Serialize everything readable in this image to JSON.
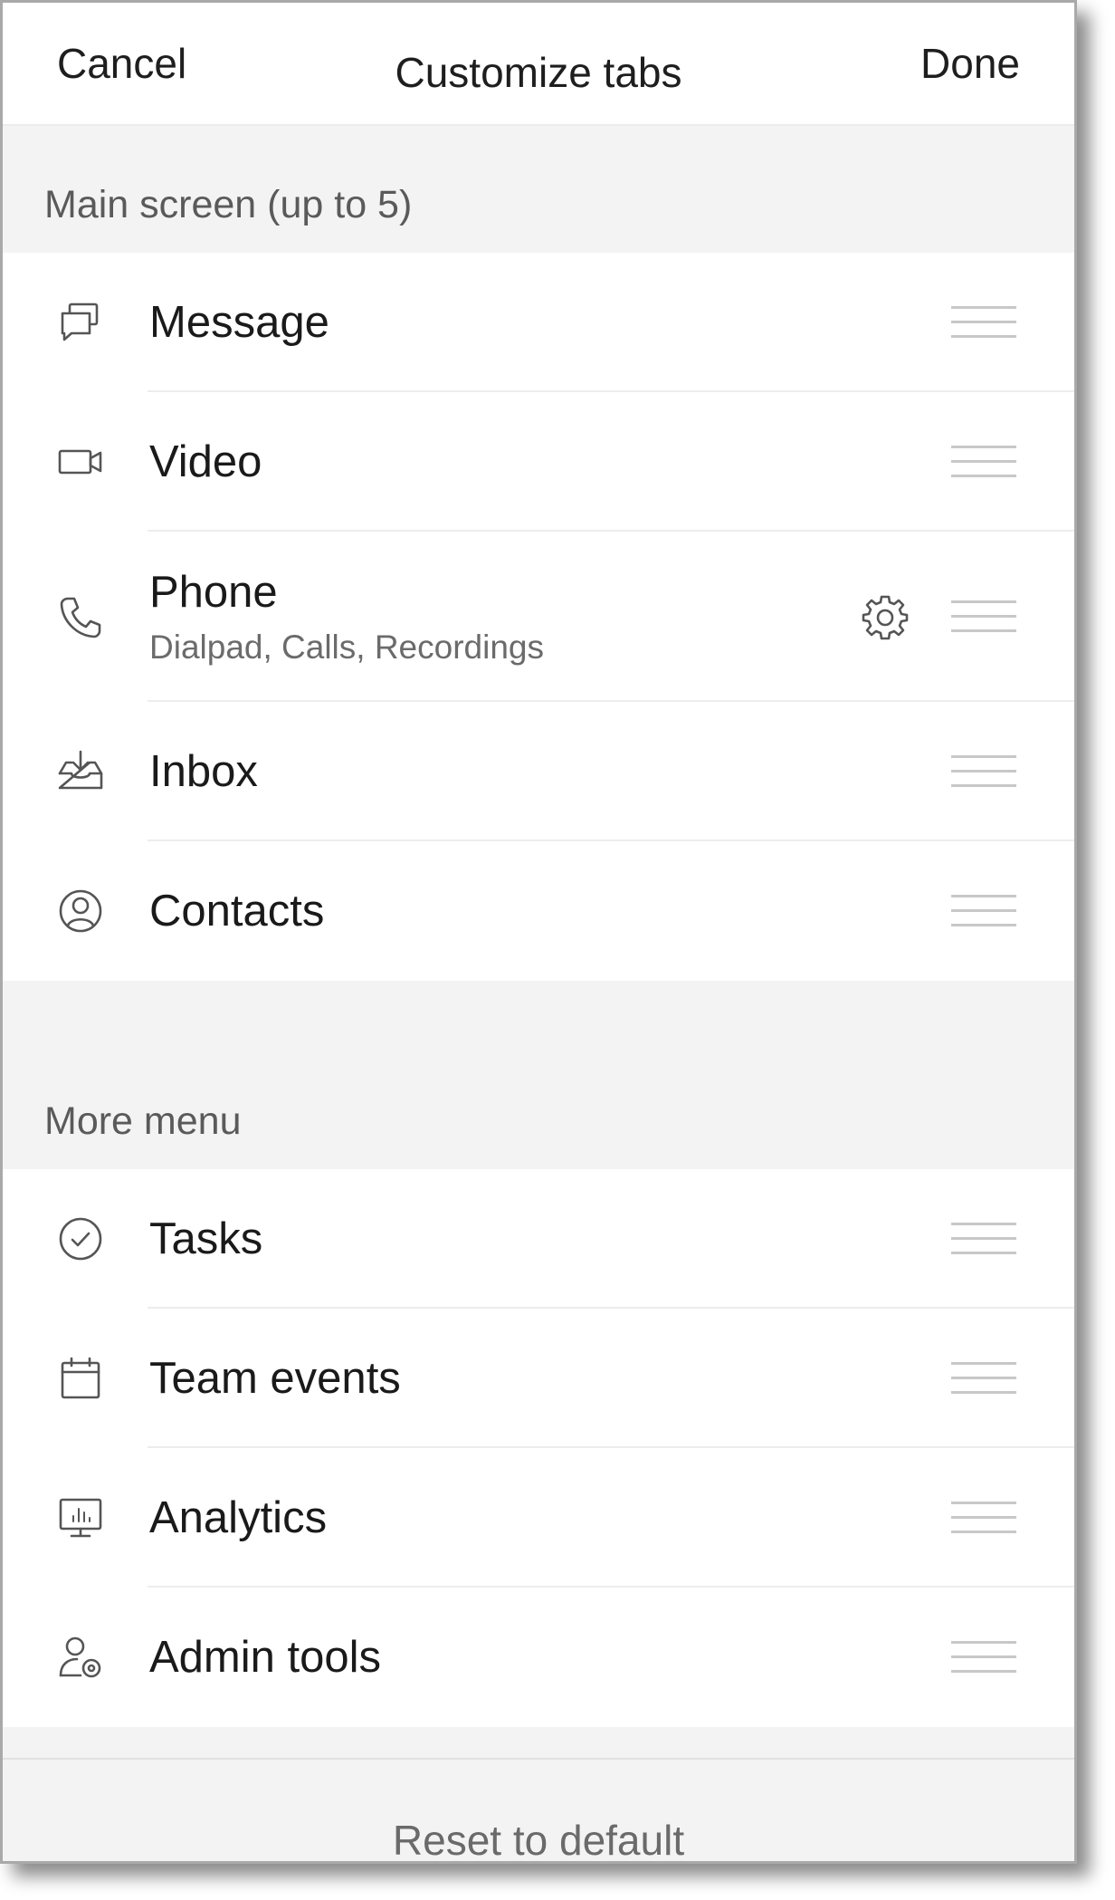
{
  "header": {
    "cancel_label": "Cancel",
    "title": "Customize tabs",
    "done_label": "Done"
  },
  "main_section": {
    "title": "Main screen (up to 5)",
    "items": [
      {
        "label": "Message",
        "icon": "message-icon"
      },
      {
        "label": "Video",
        "icon": "video-icon"
      },
      {
        "label": "Phone",
        "sublabel": "Dialpad, Calls, Recordings",
        "icon": "phone-icon",
        "settings_icon": "gear-icon"
      },
      {
        "label": "Inbox",
        "icon": "inbox-icon"
      },
      {
        "label": "Contacts",
        "icon": "contacts-icon"
      }
    ]
  },
  "more_section": {
    "title": "More menu",
    "items": [
      {
        "label": "Tasks",
        "icon": "tasks-icon"
      },
      {
        "label": "Team events",
        "icon": "calendar-icon"
      },
      {
        "label": "Analytics",
        "icon": "analytics-icon"
      },
      {
        "label": "Admin tools",
        "icon": "admin-tools-icon"
      }
    ]
  },
  "footer": {
    "reset_label": "Reset to default"
  },
  "colors": {
    "section_bg": "#f3f3f3",
    "text_primary": "#1a1a1a",
    "text_secondary": "#5a5a5a",
    "icon_stroke": "#555555",
    "drag_handle": "#c8c8c8"
  }
}
